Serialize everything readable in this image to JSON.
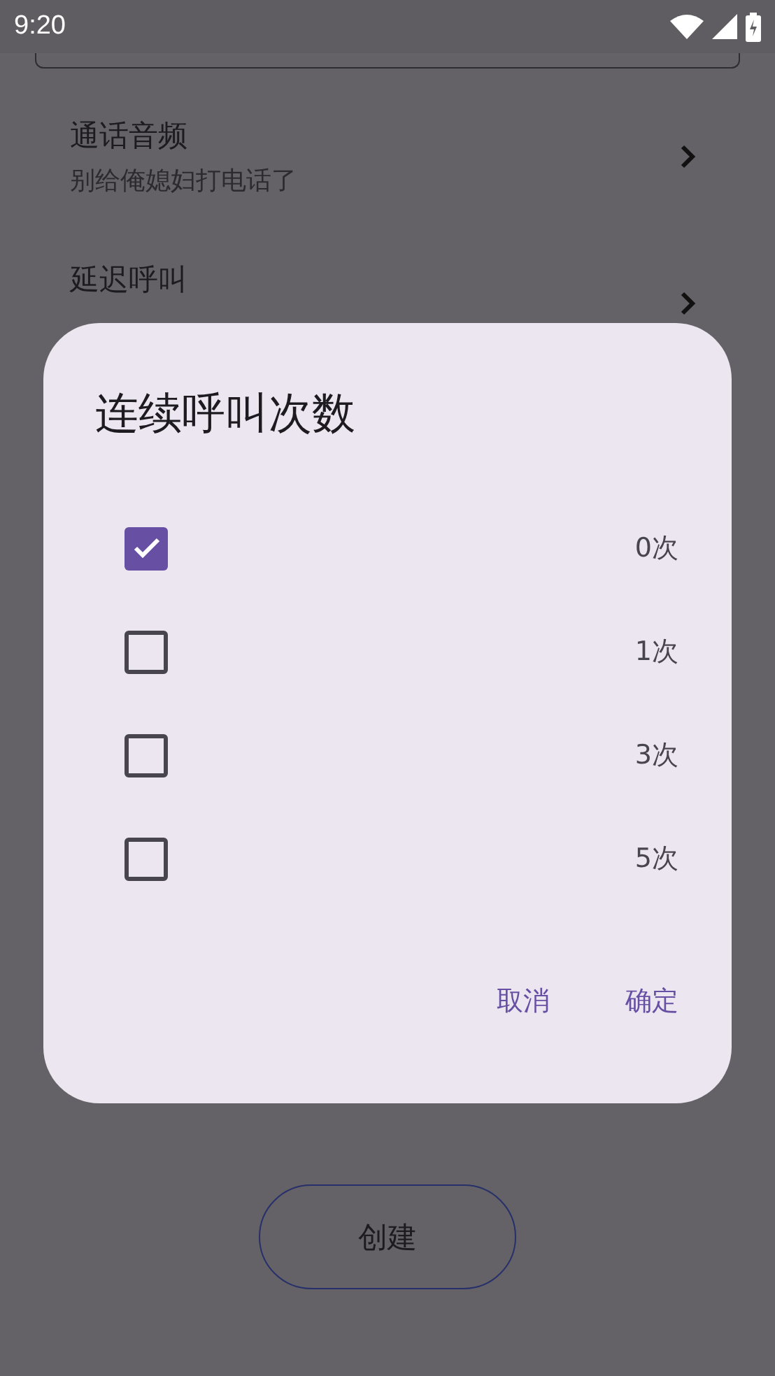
{
  "status_bar": {
    "time": "9:20"
  },
  "settings": [
    {
      "title": "通话音频",
      "subtitle": "别给俺媳妇打电话了"
    },
    {
      "title": "延迟呼叫"
    }
  ],
  "create_button": {
    "label": "创建"
  },
  "dialog": {
    "title": "连续呼叫次数",
    "options": [
      {
        "label": "0次",
        "checked": true
      },
      {
        "label": "1次",
        "checked": false
      },
      {
        "label": "3次",
        "checked": false
      },
      {
        "label": "5次",
        "checked": false
      }
    ],
    "buttons": [
      "取消",
      "确定"
    ]
  }
}
